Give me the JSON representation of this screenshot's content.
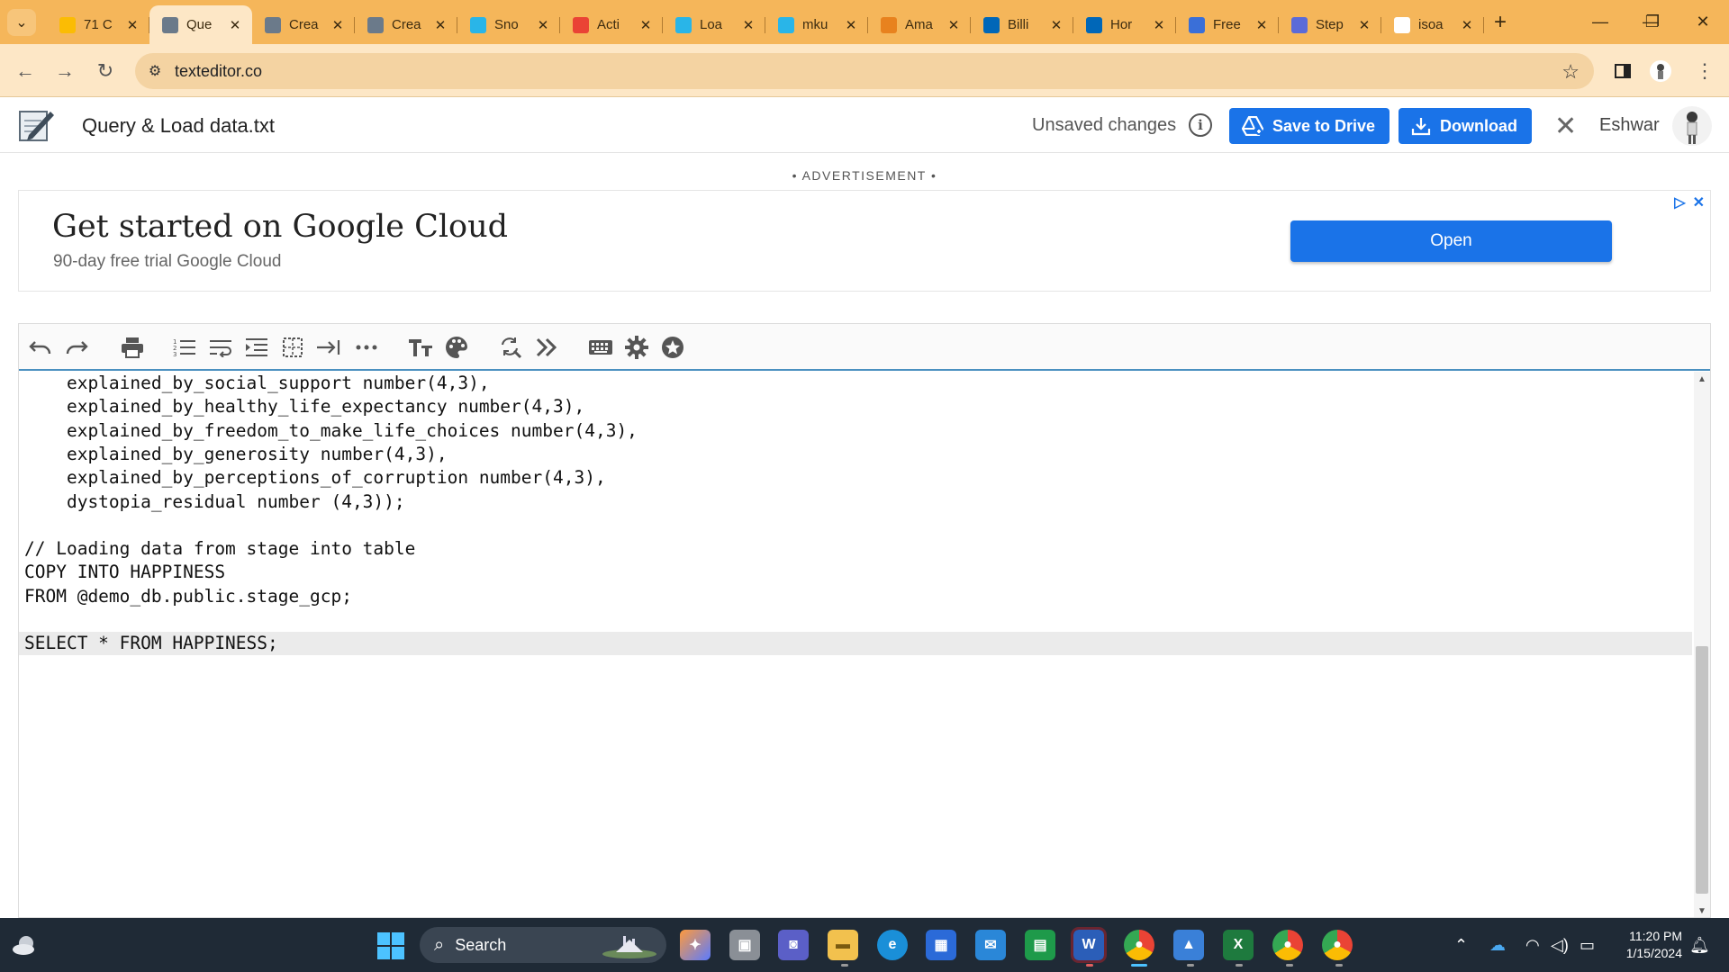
{
  "browser": {
    "tabs": [
      {
        "title": "71 C",
        "favicon": "google-drive-icon",
        "color": "#fbbc04"
      },
      {
        "title": "Que",
        "favicon": "texteditor-icon",
        "color": "#6b7a8a"
      },
      {
        "title": "Crea",
        "favicon": "texteditor-icon",
        "color": "#6b7a8a"
      },
      {
        "title": "Crea",
        "favicon": "texteditor-icon",
        "color": "#6b7a8a"
      },
      {
        "title": "Sno",
        "favicon": "snowflake-icon",
        "color": "#29b5e8"
      },
      {
        "title": "Acti",
        "favicon": "gmail-icon",
        "color": "#ea4335"
      },
      {
        "title": "Loa",
        "favicon": "snowflake-icon",
        "color": "#29b5e8"
      },
      {
        "title": "mku",
        "favicon": "snowflake-icon",
        "color": "#29b5e8"
      },
      {
        "title": "Ama",
        "favicon": "aws-box-icon",
        "color": "#e8821e"
      },
      {
        "title": "Billi",
        "favicon": "azure-icon",
        "color": "#0067b8"
      },
      {
        "title": "Hor",
        "favicon": "azure-icon",
        "color": "#0067b8"
      },
      {
        "title": "Free",
        "favicon": "cloud-icon",
        "color": "#3a6fd8"
      },
      {
        "title": "Step",
        "favicon": "puzzle-icon",
        "color": "#5b6bd8"
      },
      {
        "title": "isoa",
        "favicon": "google-icon",
        "color": "#ffffff"
      }
    ],
    "active_tab": 1,
    "url": "texteditor.co",
    "window_controls": {
      "minimize": "—",
      "restore": "❐",
      "close": "✕"
    }
  },
  "app": {
    "file_name": "Query & Load data.txt",
    "status": "Unsaved changes",
    "save_to_drive_label": "Save to Drive",
    "download_label": "Download",
    "user_name": "Eshwar"
  },
  "ad": {
    "label": "• ADVERTISEMENT •",
    "title": "Get started on Google Cloud",
    "subtitle": "90-day free trial Google Cloud",
    "button_label": "Open"
  },
  "editor": {
    "lines": [
      "    explained_by_social_support number(4,3),",
      "    explained_by_healthy_life_expectancy number(4,3),",
      "    explained_by_freedom_to_make_life_choices number(4,3),",
      "    explained_by_generosity number(4,3),",
      "    explained_by_perceptions_of_corruption number(4,3),",
      "    dystopia_residual number (4,3));",
      "",
      "// Loading data from stage into table",
      "COPY INTO HAPPINESS",
      "FROM @demo_db.public.stage_gcp;",
      "",
      "SELECT * FROM HAPPINESS;"
    ],
    "active_line": 11
  },
  "taskbar": {
    "search_label": "Search",
    "time": "11:20 PM",
    "date": "1/15/2024"
  }
}
